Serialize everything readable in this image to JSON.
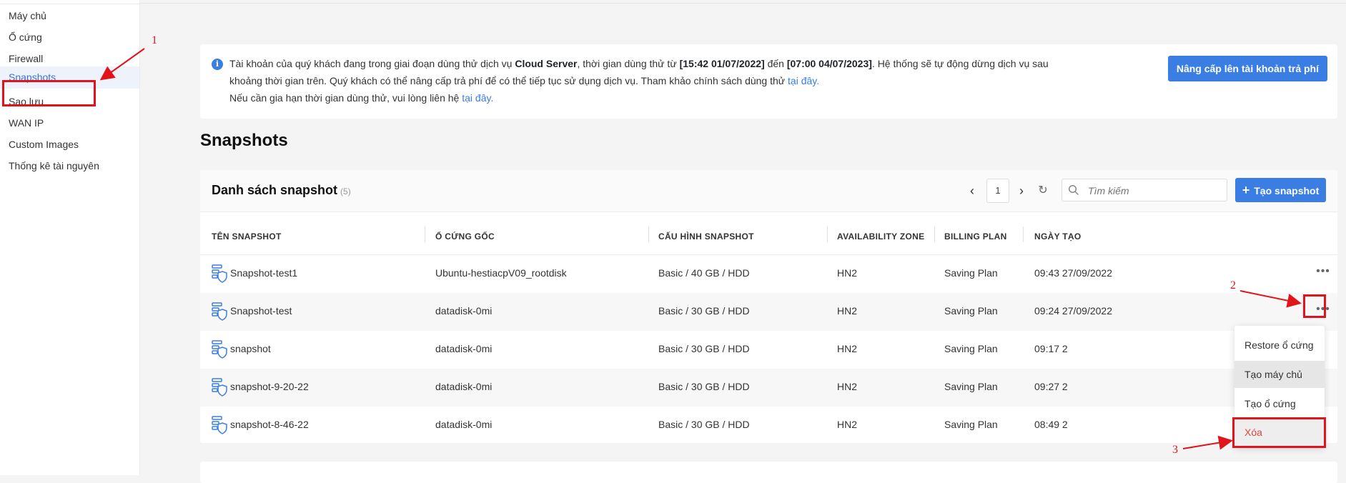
{
  "sidebar": {
    "items": [
      {
        "label": "Máy chủ",
        "active": false
      },
      {
        "label": "Ổ cứng",
        "active": false
      },
      {
        "label": "Firewall",
        "active": false
      },
      {
        "label": "Snapshots",
        "active": true
      },
      {
        "label": "Sao lưu",
        "active": false
      },
      {
        "label": "WAN IP",
        "active": false
      },
      {
        "label": "Custom Images",
        "active": false
      },
      {
        "label": "Thống kê tài nguyên",
        "active": false
      }
    ]
  },
  "notice": {
    "icon": "info-icon",
    "line1_a": "Tài khoản của quý khách đang trong giai đoạn dùng thử dịch vụ ",
    "service": "Cloud Server",
    "line1_b": ", thời gian dùng thử từ ",
    "trial_start": "[15:42 01/07/2022]",
    "line1_c": " đến ",
    "trial_end": "[07:00 04/07/2023]",
    "line1_d": ". Hệ thống sẽ tự động dừng dịch vụ sau khoảng thời gian trên. Quý khách có thể nâng cấp trả phí để có thể tiếp tục sử dụng dịch vụ. Tham khảo chính sách dùng thử ",
    "policy_link": "tại đây.",
    "line2": "Nếu cần gia hạn thời gian dùng thử, vui lòng liên hệ ",
    "contact_link": "tại đây.",
    "upgrade_button": "Nâng cấp lên tài khoản trả phí"
  },
  "page_title": "Snapshots",
  "list": {
    "title": "Danh sách snapshot",
    "count": "(5)",
    "current_page": "1",
    "search_placeholder": "Tìm kiếm",
    "create_button": "Tạo snapshot",
    "columns": [
      "TÊN SNAPSHOT",
      "Ổ CỨNG GỐC",
      "CẤU HÌNH SNAPSHOT",
      "AVAILABILITY ZONE",
      "BILLING PLAN",
      "NGÀY TẠO"
    ],
    "rows": [
      {
        "name": "Snapshot-test1",
        "disk": "Ubuntu-hestiacpV09_rootdisk",
        "config": "Basic / 40 GB / HDD",
        "zone": "HN2",
        "plan": "Saving Plan",
        "created": "09:43 27/09/2022"
      },
      {
        "name": "Snapshot-test",
        "disk": "datadisk-0mi",
        "config": "Basic / 30 GB / HDD",
        "zone": "HN2",
        "plan": "Saving Plan",
        "created": "09:24 27/09/2022"
      },
      {
        "name": "snapshot",
        "disk": "datadisk-0mi",
        "config": "Basic / 30 GB / HDD",
        "zone": "HN2",
        "plan": "Saving Plan",
        "created": "09:17 2"
      },
      {
        "name": "snapshot-9-20-22",
        "disk": "datadisk-0mi",
        "config": "Basic / 30 GB / HDD",
        "zone": "HN2",
        "plan": "Saving Plan",
        "created": "09:27 2"
      },
      {
        "name": "snapshot-8-46-22",
        "disk": "datadisk-0mi",
        "config": "Basic / 30 GB / HDD",
        "zone": "HN2",
        "plan": "Saving Plan",
        "created": "08:49 2"
      }
    ],
    "more_icon": "ellipsis-icon"
  },
  "context_menu": {
    "items": [
      "Restore ổ cứng",
      "Tạo máy chủ",
      "Tạo ổ cứng",
      "Xóa"
    ]
  },
  "annotations": {
    "step1": "1",
    "step2": "2",
    "step3": "3",
    "color": "#e0141a"
  },
  "colors": {
    "accent": "#3a7ee4",
    "danger": "#e0453a",
    "active_bg": "#eef3fb"
  }
}
